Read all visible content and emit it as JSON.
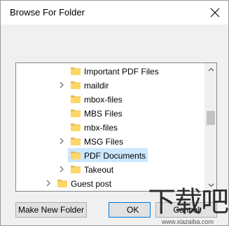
{
  "dialog": {
    "title": "Browse For Folder",
    "close_icon": "close-icon"
  },
  "tree": {
    "items": [
      {
        "label": "Important PDF Files",
        "expandable": false,
        "selected": false
      },
      {
        "label": "maildir",
        "expandable": true,
        "selected": false
      },
      {
        "label": "mbox-files",
        "expandable": false,
        "selected": false
      },
      {
        "label": "MBS Files",
        "expandable": false,
        "selected": false
      },
      {
        "label": "mbx-files",
        "expandable": false,
        "selected": false
      },
      {
        "label": "MSG Files",
        "expandable": true,
        "selected": false
      },
      {
        "label": "PDF Documents",
        "expandable": false,
        "selected": true
      },
      {
        "label": "Takeout",
        "expandable": true,
        "selected": false
      },
      {
        "label": "Guest post",
        "expandable": true,
        "selected": false
      }
    ]
  },
  "buttons": {
    "new_folder": "Make New Folder",
    "ok": "OK",
    "cancel": "Cancel"
  },
  "watermark": {
    "text": "下载吧",
    "url": "www.xiazaiba.com"
  },
  "colors": {
    "selection": "#cce8ff",
    "folder": "#ffd767",
    "default_button_border": "#0078d7"
  }
}
